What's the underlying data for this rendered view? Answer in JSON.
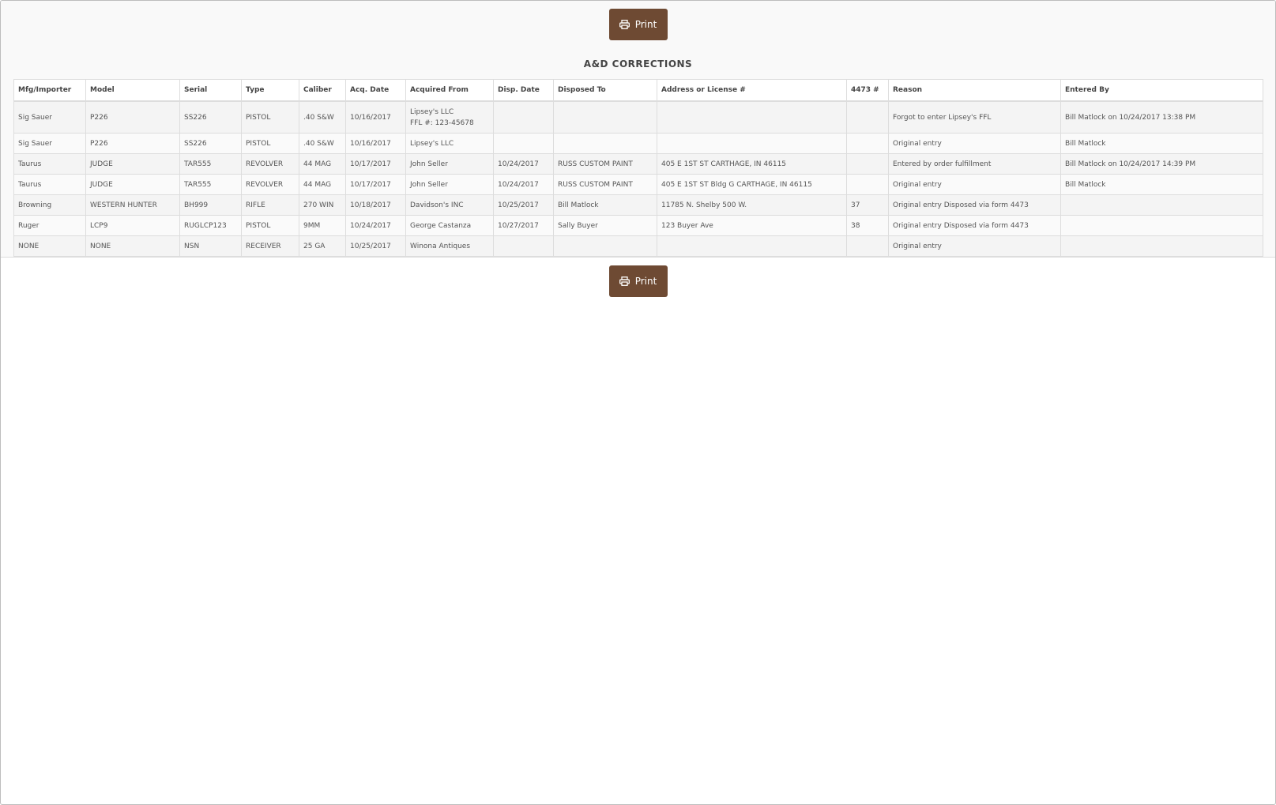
{
  "toolbar": {
    "print_label": "Print",
    "icon": "printer-icon"
  },
  "report": {
    "title": "A&D CORRECTIONS"
  },
  "table": {
    "headers": [
      "Mfg/Importer",
      "Model",
      "Serial",
      "Type",
      "Caliber",
      "Acq. Date",
      "Acquired From",
      "Disp. Date",
      "Disposed To",
      "Address or License #",
      "4473 #",
      "Reason",
      "Entered By"
    ],
    "rows": [
      {
        "mfg": "Sig Sauer",
        "model": "P226",
        "serial": "SS226",
        "type": "PISTOL",
        "caliber": ".40 S&W",
        "acq_date": "10/16/2017",
        "acquired_from": "Lipsey's LLC",
        "acquired_from_ffl": "FFL #: 123-45678",
        "disp_date": "",
        "disposed_to": "",
        "address": "",
        "form_4473": "",
        "reason": "Forgot to enter Lipsey's FFL",
        "entered_by": "Bill Matlock on 10/24/2017 13:38 PM"
      },
      {
        "mfg": "Sig Sauer",
        "model": "P226",
        "serial": "SS226",
        "type": "PISTOL",
        "caliber": ".40 S&W",
        "acq_date": "10/16/2017",
        "acquired_from": "Lipsey's LLC",
        "acquired_from_ffl": "",
        "disp_date": "",
        "disposed_to": "",
        "address": "",
        "form_4473": "",
        "reason": "Original entry",
        "entered_by": "Bill Matlock"
      },
      {
        "mfg": "Taurus",
        "model": "JUDGE",
        "serial": "TAR555",
        "type": "REVOLVER",
        "caliber": "44 MAG",
        "acq_date": "10/17/2017",
        "acquired_from": "John Seller",
        "acquired_from_ffl": "",
        "disp_date": "10/24/2017",
        "disposed_to": "RUSS CUSTOM PAINT",
        "address": "405 E 1ST ST CARTHAGE, IN 46115",
        "form_4473": "",
        "reason": "Entered by order fulfillment",
        "entered_by": "Bill Matlock on 10/24/2017 14:39 PM"
      },
      {
        "mfg": "Taurus",
        "model": "JUDGE",
        "serial": "TAR555",
        "type": "REVOLVER",
        "caliber": "44 MAG",
        "acq_date": "10/17/2017",
        "acquired_from": "John Seller",
        "acquired_from_ffl": "",
        "disp_date": "10/24/2017",
        "disposed_to": "RUSS CUSTOM PAINT",
        "address": "405 E 1ST ST Bldg G CARTHAGE, IN 46115",
        "form_4473": "",
        "reason": "Original entry",
        "entered_by": "Bill Matlock"
      },
      {
        "mfg": "Browning",
        "model": "WESTERN HUNTER",
        "serial": "BH999",
        "type": "RIFLE",
        "caliber": "270 WIN",
        "acq_date": "10/18/2017",
        "acquired_from": "Davidson's INC",
        "acquired_from_ffl": "",
        "disp_date": "10/25/2017",
        "disposed_to": "Bill Matlock",
        "address": "11785 N. Shelby 500 W.",
        "form_4473": "37",
        "reason": "Original entry Disposed via form 4473",
        "entered_by": ""
      },
      {
        "mfg": "Ruger",
        "model": "LCP9",
        "serial": "RUGLCP123",
        "type": "PISTOL",
        "caliber": "9MM",
        "acq_date": "10/24/2017",
        "acquired_from": "George Castanza",
        "acquired_from_ffl": "",
        "disp_date": "10/27/2017",
        "disposed_to": "Sally Buyer",
        "address": "123 Buyer Ave",
        "form_4473": "38",
        "reason": "Original entry Disposed via form 4473",
        "entered_by": ""
      },
      {
        "mfg": "NONE",
        "model": "NONE",
        "serial": "NSN",
        "type": "RECEIVER",
        "caliber": "25 GA",
        "acq_date": "10/25/2017",
        "acquired_from": "Winona Antiques",
        "acquired_from_ffl": "",
        "disp_date": "",
        "disposed_to": "",
        "address": "",
        "form_4473": "",
        "reason": "Original entry",
        "entered_by": ""
      }
    ]
  }
}
